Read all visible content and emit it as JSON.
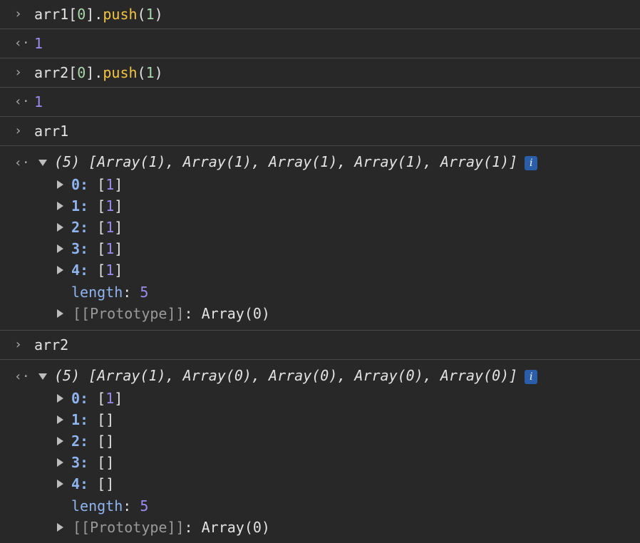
{
  "entries": [
    {
      "type": "input",
      "prompt": "›",
      "parts": [
        "arr1[",
        "0",
        "].",
        "push",
        "(",
        "1",
        ")"
      ]
    },
    {
      "type": "output",
      "prompt": "‹·",
      "value": "1"
    },
    {
      "type": "input",
      "prompt": "›",
      "parts": [
        "arr2[",
        "0",
        "].",
        "push",
        "(",
        "1",
        ")"
      ]
    },
    {
      "type": "output",
      "prompt": "‹·",
      "value": "1"
    },
    {
      "type": "input",
      "prompt": "›",
      "text": "arr1"
    },
    {
      "type": "object",
      "prompt": "‹·",
      "summary": "(5) [Array(1), Array(1), Array(1), Array(1), Array(1)]",
      "info_icon": "i",
      "items": [
        {
          "key": "0",
          "open": "[",
          "value": "1",
          "close": "]"
        },
        {
          "key": "1",
          "open": "[",
          "value": "1",
          "close": "]"
        },
        {
          "key": "2",
          "open": "[",
          "value": "1",
          "close": "]"
        },
        {
          "key": "3",
          "open": "[",
          "value": "1",
          "close": "]"
        },
        {
          "key": "4",
          "open": "[",
          "value": "1",
          "close": "]"
        }
      ],
      "length_label": "length",
      "length_value": "5",
      "prototype_label": "[[Prototype]]",
      "prototype_value": "Array(0)"
    },
    {
      "type": "input",
      "prompt": "›",
      "text": "arr2"
    },
    {
      "type": "object",
      "prompt": "‹·",
      "summary": "(5) [Array(1), Array(0), Array(0), Array(0), Array(0)]",
      "info_icon": "i",
      "items": [
        {
          "key": "0",
          "open": "[",
          "value": "1",
          "close": "]"
        },
        {
          "key": "1",
          "open": "[",
          "value": "",
          "close": "]"
        },
        {
          "key": "2",
          "open": "[",
          "value": "",
          "close": "]"
        },
        {
          "key": "3",
          "open": "[",
          "value": "",
          "close": "]"
        },
        {
          "key": "4",
          "open": "[",
          "value": "",
          "close": "]"
        }
      ],
      "length_label": "length",
      "length_value": "5",
      "prototype_label": "[[Prototype]]",
      "prototype_value": "Array(0)"
    }
  ]
}
